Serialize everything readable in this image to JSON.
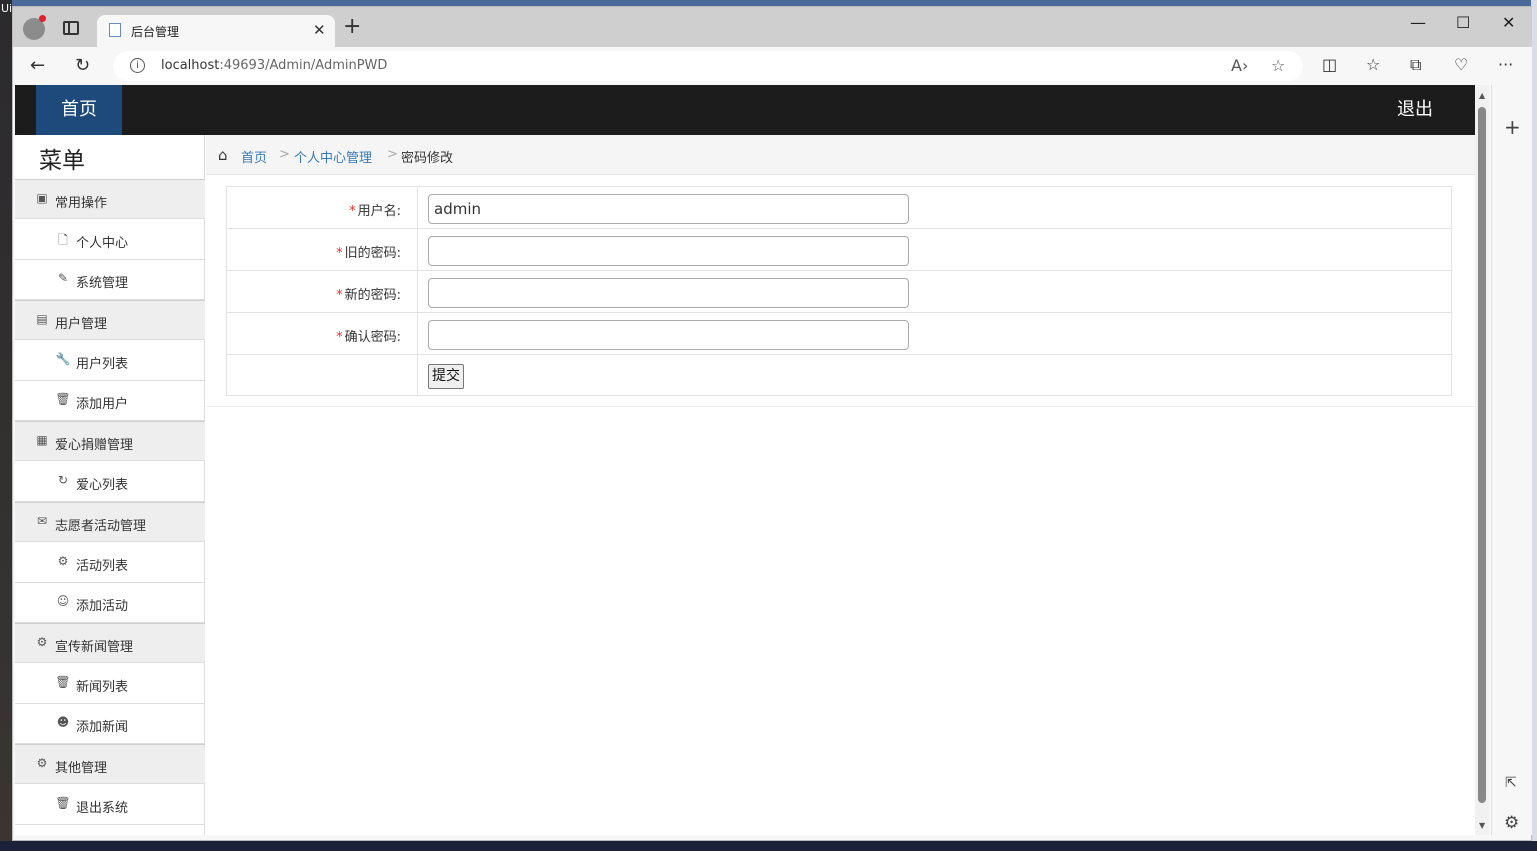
{
  "desktop_text": "Ui",
  "browser": {
    "tab_title": "后台管理",
    "url_host": "localhost",
    "url_rest": ":49693/Admin/AdminPWD"
  },
  "header": {
    "home_label": "首页",
    "logout_label": "退出"
  },
  "menu": {
    "title": "菜单",
    "rows": [
      {
        "type": "group",
        "icon": "▣",
        "label": "常用操作"
      },
      {
        "type": "item",
        "icon": "🗋",
        "label": "个人中心"
      },
      {
        "type": "item",
        "icon": "✎",
        "label": "系统管理"
      },
      {
        "type": "group",
        "icon": "▤",
        "label": "用户管理"
      },
      {
        "type": "item",
        "icon": "🔧",
        "label": "用户列表"
      },
      {
        "type": "item",
        "icon": "🗑",
        "label": "添加用户"
      },
      {
        "type": "group",
        "icon": "▦",
        "label": "爱心捐赠管理"
      },
      {
        "type": "item",
        "icon": "↻",
        "label": "爱心列表"
      },
      {
        "type": "group",
        "icon": "✉",
        "label": "志愿者活动管理"
      },
      {
        "type": "item",
        "icon": "⚙",
        "label": "活动列表"
      },
      {
        "type": "item",
        "icon": "☺",
        "label": "添加活动"
      },
      {
        "type": "group",
        "icon": "⚙",
        "label": "宣传新闻管理"
      },
      {
        "type": "item",
        "icon": "🗑",
        "label": "新闻列表"
      },
      {
        "type": "item",
        "icon": "☻",
        "label": "添加新闻"
      },
      {
        "type": "group",
        "icon": "⚙",
        "label": "其他管理"
      },
      {
        "type": "item",
        "icon": "🗑",
        "label": "退出系统"
      }
    ]
  },
  "breadcrumb": {
    "home": "首页",
    "sep": ">",
    "section": "个人中心管理",
    "current": "密码修改"
  },
  "form": {
    "required_mark": "*",
    "username_label": "用户名:",
    "username_value": "admin",
    "old_password_label": "旧的密码:",
    "new_password_label": "新的密码:",
    "confirm_password_label": "确认密码:",
    "submit_label": "提交"
  }
}
